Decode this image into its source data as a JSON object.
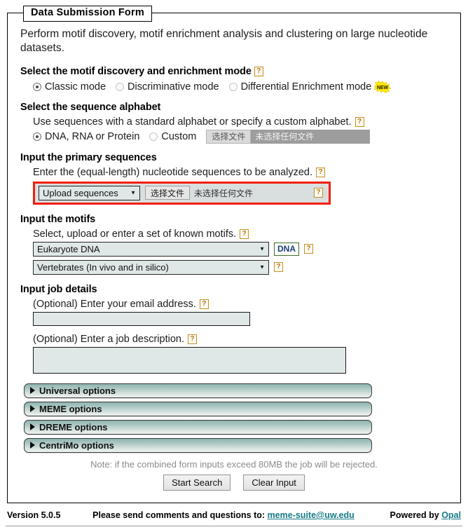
{
  "form": {
    "legend": "Data Submission Form",
    "intro": "Perform motif discovery, motif enrichment analysis and clustering on large nucleotide datasets.",
    "help_glyph": "?"
  },
  "mode_section": {
    "title": "Select the motif discovery and enrichment mode",
    "options": [
      {
        "label": "Classic mode",
        "selected": true
      },
      {
        "label": "Discriminative mode",
        "selected": false
      },
      {
        "label": "Differential Enrichment mode",
        "selected": false
      }
    ],
    "new_badge_label": "NEW",
    "new_badge_color": "#ffe600"
  },
  "alphabet_section": {
    "title": "Select the sequence alphabet",
    "subtitle": "Use sequences with a standard alphabet or specify a custom alphabet.",
    "options": [
      {
        "label": "DNA, RNA or Protein",
        "selected": true
      },
      {
        "label": "Custom",
        "selected": false
      }
    ],
    "file_button": "选择文件",
    "file_status": "未选择任何文件"
  },
  "sequences_section": {
    "title": "Input the primary sequences",
    "subtitle": "Enter the (equal-length) nucleotide sequences to be analyzed.",
    "source_select": "Upload sequences",
    "file_button": "选择文件",
    "file_status": "未选择任何文件",
    "highlight_color": "#f21f0e"
  },
  "motifs_section": {
    "title": "Input the motifs",
    "subtitle": "Select, upload or enter a set of known motifs.",
    "db_select": "Eukaryote DNA",
    "alphabet_badge": "DNA",
    "subset_select": "Vertebrates (In vivo and in silico)"
  },
  "job_section": {
    "title": "Input job details",
    "email_label": "(Optional) Enter your email address.",
    "email_value": "",
    "description_label": "(Optional) Enter a job description.",
    "description_value": ""
  },
  "option_bars": [
    {
      "label": "Universal options"
    },
    {
      "label": "MEME options"
    },
    {
      "label": "DREME options"
    },
    {
      "label": "CentriMo options"
    }
  ],
  "actions": {
    "note": "Note: if the combined form inputs exceed 80MB the job will be rejected.",
    "submit": "Start Search",
    "clear": "Clear Input"
  },
  "footer": {
    "version": "Version 5.0.5",
    "contact_prefix": "Please send comments and questions to:",
    "contact_email": "meme-suite@uw.edu",
    "powered_prefix": "Powered by",
    "powered_name": "Opal",
    "link_color": "#157a86"
  }
}
